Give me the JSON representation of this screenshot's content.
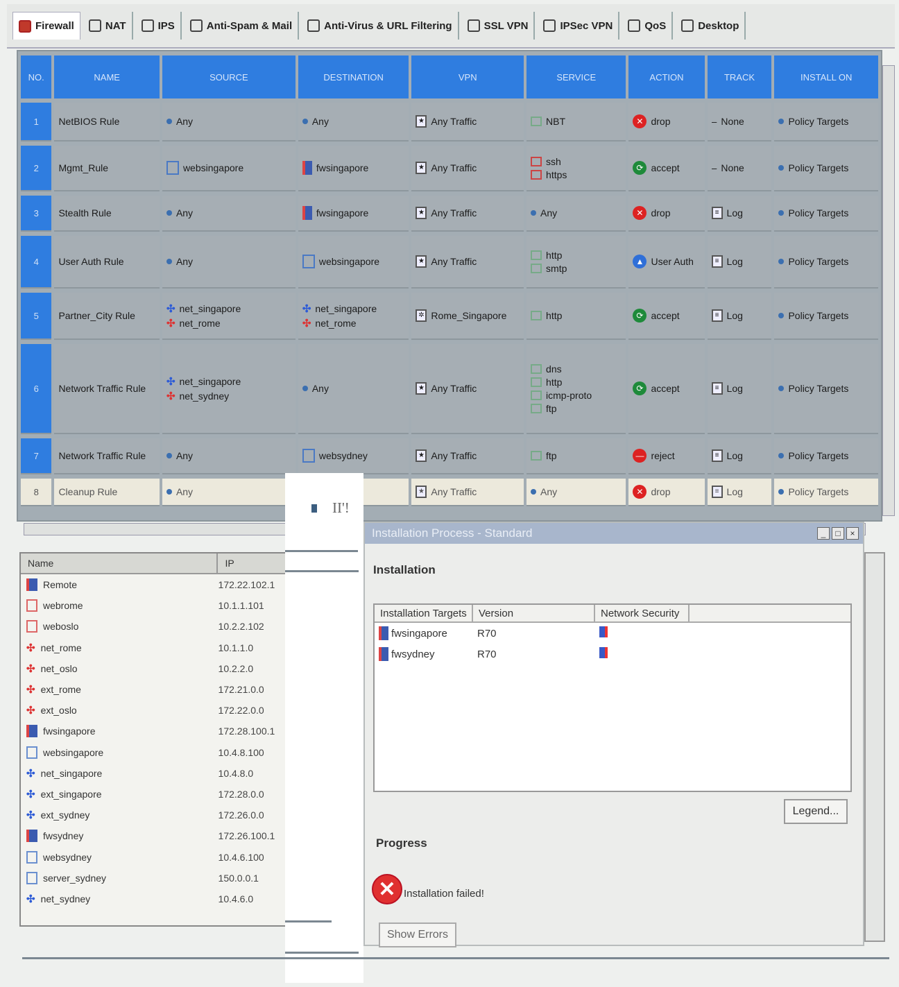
{
  "tabs": [
    {
      "label": "Firewall",
      "icon": "firewall-icon",
      "active": true
    },
    {
      "label": "NAT",
      "icon": "nat-icon"
    },
    {
      "label": "IPS",
      "icon": "ips-icon"
    },
    {
      "label": "Anti-Spam & Mail",
      "icon": "anti-spam-icon"
    },
    {
      "label": "Anti-Virus & URL Filtering",
      "icon": "anti-virus-icon"
    },
    {
      "label": "SSL VPN",
      "icon": "ssl-vpn-icon"
    },
    {
      "label": "IPSec VPN",
      "icon": "ipsec-vpn-icon"
    },
    {
      "label": "QoS",
      "icon": "qos-icon"
    },
    {
      "label": "Desktop",
      "icon": "desktop-icon"
    }
  ],
  "rules": {
    "columns": [
      "NO.",
      "NAME",
      "SOURCE",
      "DESTINATION",
      "VPN",
      "SERVICE",
      "ACTION",
      "TRACK",
      "INSTALL ON"
    ],
    "rows": [
      {
        "no": "1",
        "name": "NetBIOS Rule",
        "source": [
          "Any"
        ],
        "destination": [
          "Any"
        ],
        "vpn": "Any Traffic",
        "service": [
          "NBT"
        ],
        "action": "drop",
        "track": "None",
        "install": "Policy Targets"
      },
      {
        "no": "2",
        "name": "Mgmt_Rule",
        "source": [
          "websingapore"
        ],
        "destination": [
          "fwsingapore"
        ],
        "vpn": "Any Traffic",
        "service": [
          "ssh",
          "https"
        ],
        "action": "accept",
        "track": "None",
        "install": "Policy Targets"
      },
      {
        "no": "3",
        "name": "Stealth Rule",
        "source": [
          "Any"
        ],
        "destination": [
          "fwsingapore"
        ],
        "vpn": "Any Traffic",
        "service": [
          "Any"
        ],
        "action": "drop",
        "track": "Log",
        "install": "Policy Targets"
      },
      {
        "no": "4",
        "name": "User Auth Rule",
        "source": [
          "Any"
        ],
        "destination": [
          "websingapore"
        ],
        "vpn": "Any Traffic",
        "service": [
          "http",
          "smtp"
        ],
        "action": "User Auth",
        "track": "Log",
        "install": "Policy Targets"
      },
      {
        "no": "5",
        "name": "Partner_City Rule",
        "source": [
          "net_singapore",
          "net_rome"
        ],
        "destination": [
          "net_singapore",
          "net_rome"
        ],
        "vpn": "Rome_Singapore",
        "service": [
          "http"
        ],
        "action": "accept",
        "track": "Log",
        "install": "Policy Targets"
      },
      {
        "no": "6",
        "name": "Network Traffic Rule",
        "source": [
          "net_singapore",
          "net_sydney"
        ],
        "destination": [
          "Any"
        ],
        "vpn": "Any Traffic",
        "service": [
          "dns",
          "http",
          "icmp-proto",
          "ftp"
        ],
        "action": "accept",
        "track": "Log",
        "install": "Policy Targets"
      },
      {
        "no": "7",
        "name": "Network Traffic Rule",
        "source": [
          "Any"
        ],
        "destination": [
          "websydney"
        ],
        "vpn": "Any Traffic",
        "service": [
          "ftp"
        ],
        "action": "reject",
        "track": "Log",
        "install": "Policy Targets"
      },
      {
        "no": "8",
        "name": "Cleanup Rule",
        "source": [
          "Any"
        ],
        "destination": [
          ""
        ],
        "vpn": "Any Traffic",
        "service": [
          "Any"
        ],
        "action": "drop",
        "track": "Log",
        "install": "Policy Targets"
      }
    ]
  },
  "objects": {
    "columns": [
      "Name",
      "IP"
    ],
    "rows": [
      {
        "name": "Remote",
        "ip": "172.22.102.1"
      },
      {
        "name": "webrome",
        "ip": "10.1.1.101"
      },
      {
        "name": "weboslo",
        "ip": "10.2.2.102"
      },
      {
        "name": "net_rome",
        "ip": "10.1.1.0"
      },
      {
        "name": "net_oslo",
        "ip": "10.2.2.0"
      },
      {
        "name": "ext_rome",
        "ip": "172.21.0.0"
      },
      {
        "name": "ext_oslo",
        "ip": "172.22.0.0"
      },
      {
        "name": "fwsingapore",
        "ip": "172.28.100.1"
      },
      {
        "name": "websingapore",
        "ip": "10.4.8.100"
      },
      {
        "name": "net_singapore",
        "ip": "10.4.8.0"
      },
      {
        "name": "ext_singapore",
        "ip": "172.28.0.0"
      },
      {
        "name": "ext_sydney",
        "ip": "172.26.0.0"
      },
      {
        "name": "fwsydney",
        "ip": "172.26.100.1"
      },
      {
        "name": "websydney",
        "ip": "10.4.6.100"
      },
      {
        "name": "server_sydney",
        "ip": "150.0.0.1"
      },
      {
        "name": "net_sydney",
        "ip": "10.4.6.0"
      }
    ]
  },
  "overlay": {
    "text": "II'!"
  },
  "dialog": {
    "title": "Installation Process - Standard",
    "installation_label": "Installation",
    "columns": [
      "Installation Targets",
      "Version",
      "Network Security"
    ],
    "targets": [
      {
        "name": "fwsingapore",
        "version": "R70"
      },
      {
        "name": "fwsydney",
        "version": "R70"
      }
    ],
    "legend_button": "Legend...",
    "progress_label": "Progress",
    "status": "Installation failed!",
    "show_errors_button": "Show Errors",
    "controls": [
      "_",
      "□",
      "×"
    ]
  }
}
